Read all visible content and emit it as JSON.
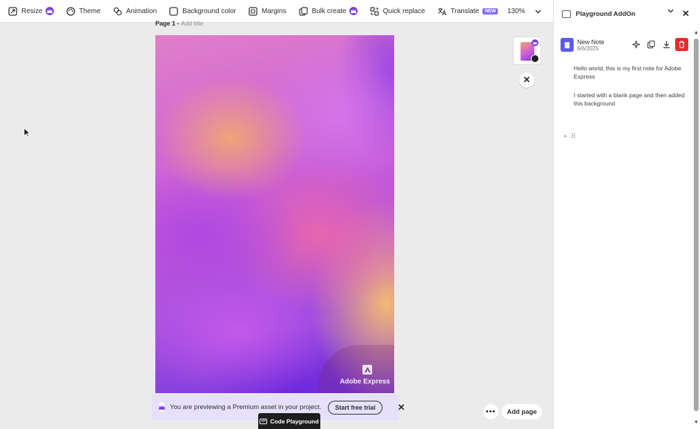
{
  "toolbar": {
    "items": [
      {
        "label": "Resize",
        "icon": "resize-icon",
        "premium": true
      },
      {
        "label": "Theme",
        "icon": "palette-icon"
      },
      {
        "label": "Animation",
        "icon": "animation-icon"
      },
      {
        "label": "Background color",
        "icon": "background-color-icon"
      },
      {
        "label": "Margins",
        "icon": "margins-icon"
      },
      {
        "label": "Bulk create",
        "icon": "bulk-create-icon",
        "premium": true
      },
      {
        "label": "Quick replace",
        "icon": "quick-replace-icon"
      },
      {
        "label": "Translate",
        "icon": "translate-icon",
        "badge": "NEW"
      }
    ],
    "zoom": "130%"
  },
  "canvas": {
    "page_label": "Page 1 - ",
    "title_placeholder": "Add title",
    "watermark": "Adobe Express"
  },
  "premium_banner": {
    "text": "You are previewing a Premium asset in your project.",
    "trial_button": "Start free trial"
  },
  "code_playground": "Code Playground",
  "bottom_actions": {
    "more": "•••",
    "add_page": "Add page"
  },
  "panel": {
    "title": "Playground AddOn",
    "note": {
      "title": "New Note",
      "date": "6/6/2025",
      "paragraphs": [
        "Hello world, this is my first note for Adobe Express",
        "I started with a blank page and then added this background"
      ]
    }
  },
  "colors": {
    "premium": "#7b3fe4",
    "new_badge": "#7b6cf6",
    "delete": "#e02e2e",
    "note_icon": "#5b5be8",
    "banner_bg": "#e6e0fb"
  }
}
